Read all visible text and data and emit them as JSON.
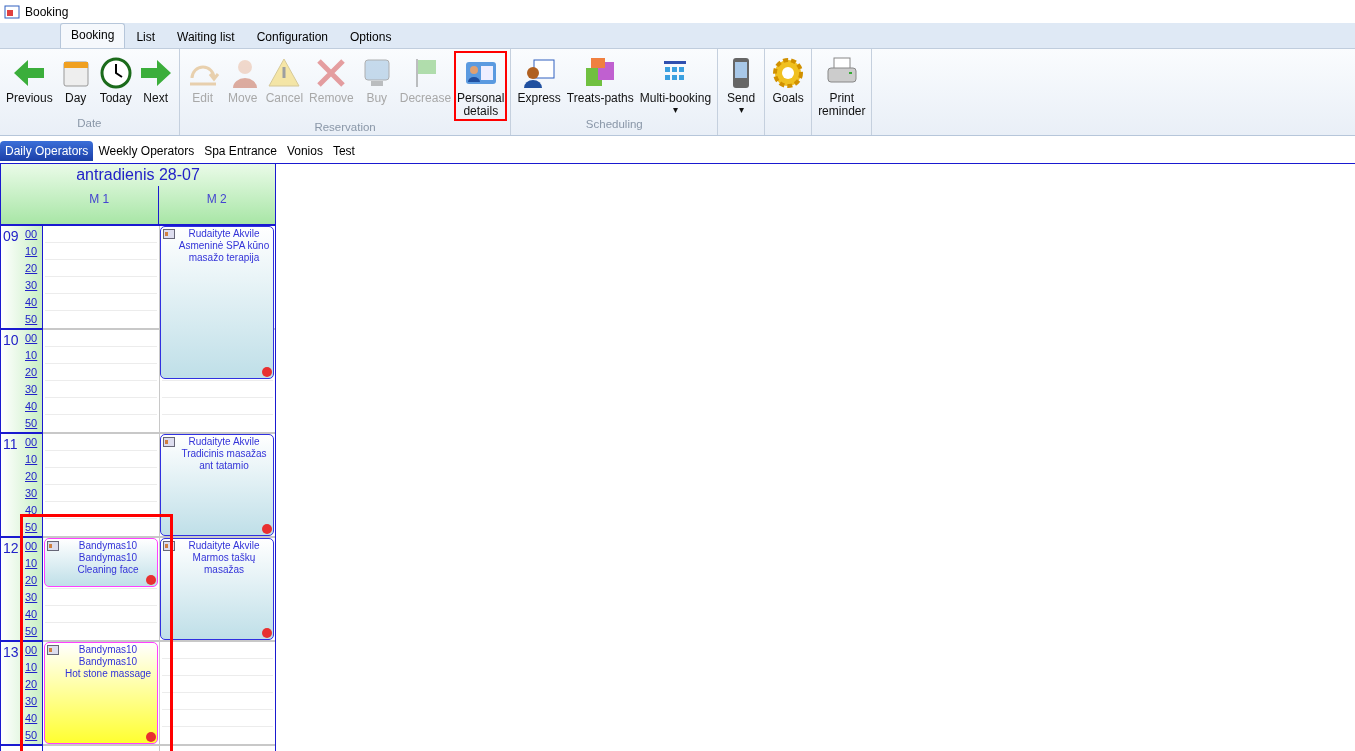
{
  "window": {
    "title": "Booking"
  },
  "ribbon_tabs": [
    {
      "label": "Booking",
      "selected": true
    },
    {
      "label": "List",
      "selected": false
    },
    {
      "label": "Waiting list",
      "selected": false
    },
    {
      "label": "Configuration",
      "selected": false
    },
    {
      "label": "Options",
      "selected": false
    }
  ],
  "ribbon_groups": [
    {
      "label": "Date",
      "buttons": [
        {
          "label": [
            "Previous"
          ],
          "disabled": false
        },
        {
          "label": [
            "Day"
          ],
          "disabled": false
        },
        {
          "label": [
            "Today"
          ],
          "disabled": false
        },
        {
          "label": [
            "Next"
          ],
          "disabled": false
        }
      ]
    },
    {
      "label": "Reservation",
      "buttons": [
        {
          "label": [
            "Edit"
          ],
          "disabled": true
        },
        {
          "label": [
            "Move"
          ],
          "disabled": true
        },
        {
          "label": [
            "Cancel"
          ],
          "disabled": true
        },
        {
          "label": [
            "Remove"
          ],
          "disabled": true
        },
        {
          "label": [
            "Buy"
          ],
          "disabled": true
        },
        {
          "label": [
            "Decrease"
          ],
          "disabled": true
        },
        {
          "label": [
            "Personal",
            "details"
          ],
          "disabled": false,
          "highlighted": true
        }
      ]
    },
    {
      "label": "Scheduling",
      "buttons": [
        {
          "label": [
            "Express"
          ],
          "disabled": false
        },
        {
          "label": [
            "Treats-paths"
          ],
          "disabled": false
        },
        {
          "label": [
            "Multi-booking"
          ],
          "disabled": false,
          "caret": "▾"
        }
      ]
    },
    {
      "buttons": [
        {
          "label": [
            "Send"
          ],
          "disabled": false,
          "caret": "▾"
        }
      ]
    },
    {
      "buttons": [
        {
          "label": [
            "Goals"
          ],
          "disabled": false
        }
      ]
    },
    {
      "buttons": [
        {
          "label": [
            "Print",
            "reminder"
          ],
          "disabled": false
        }
      ]
    }
  ],
  "view_tabs": [
    {
      "label": "Daily Operators",
      "selected": true
    },
    {
      "label": "Weekly Operators",
      "selected": false
    },
    {
      "label": "Spa Entrance",
      "selected": false
    },
    {
      "label": "Vonios",
      "selected": false
    },
    {
      "label": "Test",
      "selected": false
    }
  ],
  "calendar": {
    "date": "antradienis 28-07",
    "columns": [
      "M 1",
      "M 2"
    ],
    "hours": [
      {
        "hour": "09",
        "minutes": [
          "00",
          "10",
          "20",
          "30",
          "40",
          "50"
        ]
      },
      {
        "hour": "10",
        "minutes": [
          "00",
          "10",
          "20",
          "30",
          "40",
          "50"
        ]
      },
      {
        "hour": "11",
        "minutes": [
          "00",
          "10",
          "20",
          "30",
          "40",
          "50"
        ]
      },
      {
        "hour": "12",
        "minutes": [
          "00",
          "10",
          "20",
          "30",
          "40",
          "50"
        ]
      },
      {
        "hour": "13",
        "minutes": [
          "00",
          "10",
          "20",
          "30",
          "40",
          "50"
        ]
      }
    ],
    "appointments": [
      {
        "lines": [
          "Rudaityte Akvile",
          "Asmeninė SPA kūno masažo terapija"
        ],
        "color": "#bfdfe8",
        "highlighted": false
      },
      {
        "lines": [
          "Rudaityte Akvile",
          "Tradicinis masažas ant tatamio"
        ],
        "color": "#bfdfe8",
        "highlighted": false
      },
      {
        "lines": [
          "Bandymas10",
          "Bandymas10",
          "Cleaning face"
        ],
        "color": "#bfdfe8",
        "highlighted": true
      },
      {
        "lines": [
          "Rudaityte Akvile",
          "Marmos taškų masažas"
        ],
        "color": "#bfdfe8",
        "highlighted": false
      },
      {
        "lines": [
          "Bandymas10",
          "Bandymas10",
          "Hot stone massage"
        ],
        "color": "#ffff30",
        "highlighted": true
      }
    ]
  }
}
